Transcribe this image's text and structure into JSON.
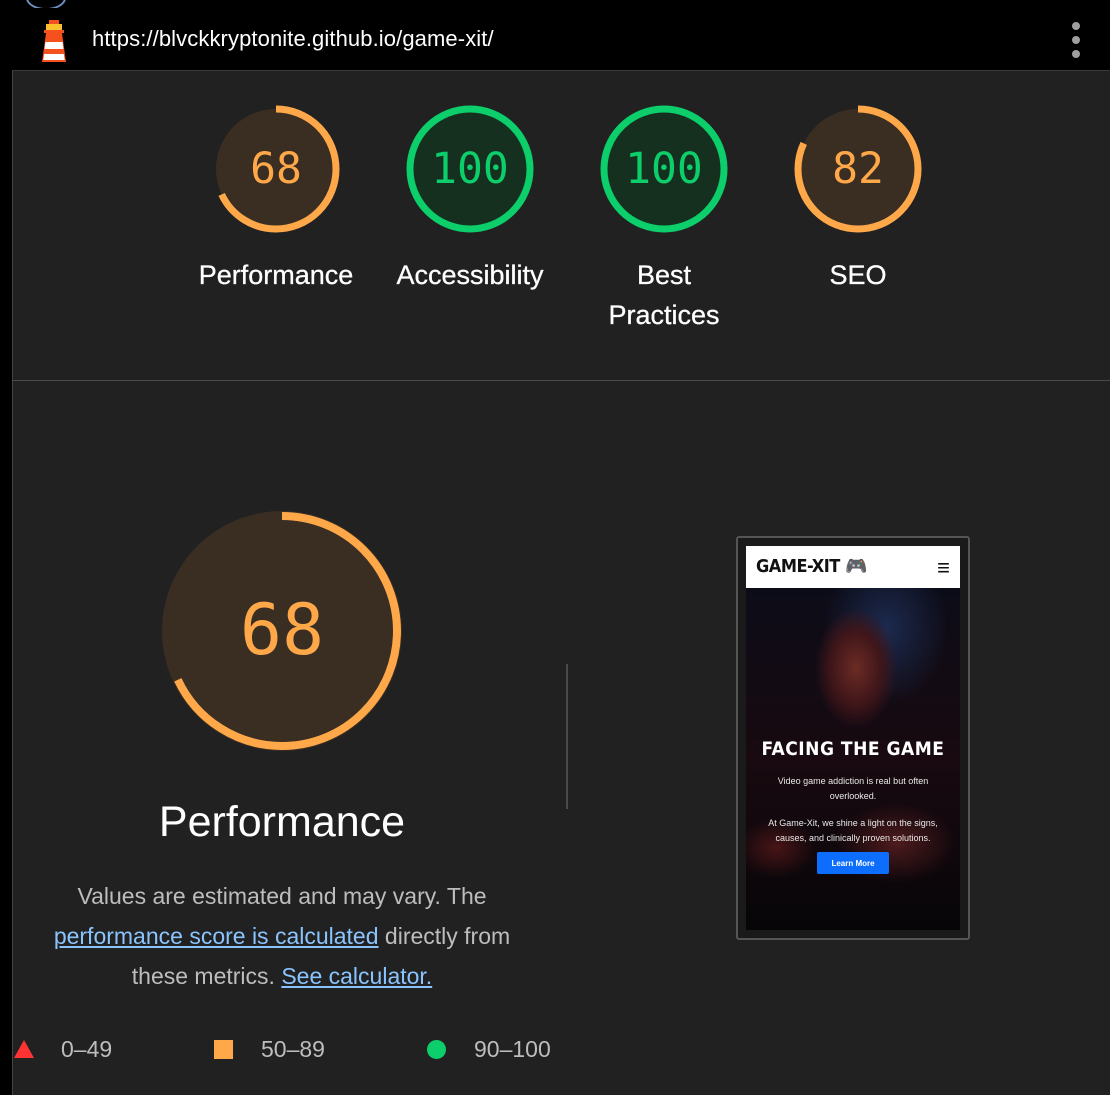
{
  "colors": {
    "average": "#ffa84a",
    "pass": "#0cce6b",
    "fail": "#ff3333",
    "link": "#8ac4ff"
  },
  "topbar": {
    "logo_icon": "lighthouse-icon",
    "url": "https://blvckkryptonite.github.io/game-xit/",
    "menu_icon": "vertical-dots-icon"
  },
  "gauges": [
    {
      "label": "Performance",
      "score": 68,
      "rating": "average"
    },
    {
      "label": "Accessibility",
      "score": 100,
      "rating": "pass"
    },
    {
      "label": "Best Practices",
      "score": 100,
      "rating": "pass"
    },
    {
      "label": "SEO",
      "score": 82,
      "rating": "average"
    }
  ],
  "performance": {
    "score": 68,
    "title": "Performance",
    "desc_before": "Values are estimated and may vary. The ",
    "desc_link1": "performance score is calculated",
    "desc_middle": " directly from these metrics. ",
    "desc_link2": "See calculator."
  },
  "screenshot": {
    "brand": "GAME-XIT 🎮",
    "menu_icon": "hamburger-icon",
    "heading": "FACING THE GAME",
    "text1": "Video game addiction is real but often overlooked.",
    "text2": "At Game-Xit, we shine a light on the signs, causes, and clinically proven solutions.",
    "button": "Learn More"
  },
  "legend": [
    {
      "shape": "triangle",
      "range": "0–49"
    },
    {
      "shape": "square",
      "range": "50–89"
    },
    {
      "shape": "circle",
      "range": "90–100"
    }
  ]
}
